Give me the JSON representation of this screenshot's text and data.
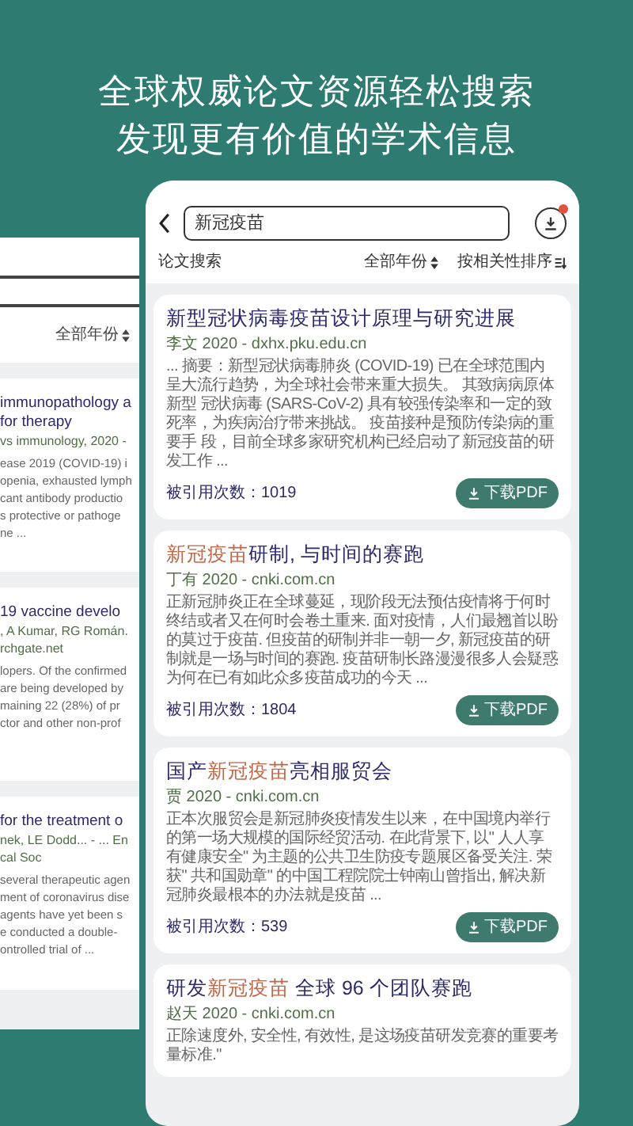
{
  "headline": [
    "全球权威论文资源轻松搜索",
    "发现更有价值的学术信息"
  ],
  "back_panel": {
    "year_filter": "全部年份",
    "cards": [
      {
        "title_lines": [
          "immunopathology a",
          "for therapy"
        ],
        "meta_lines": [
          "vs immunology, 2020 -"
        ],
        "body_lines": [
          "ease 2019 (COVID-19) i",
          "openia, exhausted lymph",
          "cant antibody productio",
          "s protective or pathoge",
          "ne ..."
        ]
      },
      {
        "title_lines": [
          "19 vaccine develo"
        ],
        "meta_lines": [
          ", A Kumar, RG Román.",
          "rchgate.net"
        ],
        "body_lines": [
          "lopers. Of the confirmed",
          "are being developed by",
          "maining 22 (28%) of pr",
          "ctor and other non-prof"
        ]
      },
      {
        "title_lines": [
          "for the treatment o"
        ],
        "meta_lines": [
          "nek, LE Dodd... - ... En",
          "cal Soc"
        ],
        "body_lines": [
          "several therapeutic agen",
          "ment of coronavirus dise",
          "agents have yet been s",
          "e conducted a double-",
          "ontrolled trial of ..."
        ]
      }
    ]
  },
  "phone": {
    "search": {
      "value": "新冠疫苗"
    },
    "download_badge": true,
    "filters": {
      "label": "论文搜索",
      "year": "全部年份",
      "sort": "按相关性排序"
    },
    "results": [
      {
        "title_parts": [
          {
            "text": "新型冠状病毒疫苗设计原理与研究进展",
            "highlight": false
          }
        ],
        "meta": "李文 2020 - dxhx.pku.edu.cn",
        "abstract": "... 摘要：新型冠状病毒肺炎 (COVID-19) 已在全球范围内呈大流行趋势，为全球社会带来重大损失。 其致病病原体新型 冠状病毒 (SARS-CoV-2) 具有较强传染率和一定的致死率，为疾病治疗带来挑战。 疫苗接种是预防传染病的重要手 段，目前全球多家研究机构已经启动了新冠疫苗的研发工作 ...",
        "citations": "被引用次数：1019",
        "download": "下载PDF"
      },
      {
        "title_parts": [
          {
            "text": "新冠疫苗",
            "highlight": true
          },
          {
            "text": "研制, 与时间的赛跑",
            "highlight": false
          }
        ],
        "meta": "丁有 2020 - cnki.com.cn",
        "abstract": "正新冠肺炎正在全球蔓延，现阶段无法预估疫情将于何时终结或者又在何时会卷土重来. 面对疫情，人们最翘首以盼的莫过于疫苗. 但疫苗的研制并非一朝一夕, 新冠疫苗的研制就是一场与时间的赛跑. 疫苗研制长路漫漫很多人会疑惑为何在已有如此众多疫苗成功的今天 ...",
        "citations": "被引用次数：1804",
        "download": "下载PDF"
      },
      {
        "title_parts": [
          {
            "text": "国产",
            "highlight": false
          },
          {
            "text": "新冠疫苗",
            "highlight": true
          },
          {
            "text": "亮相服贸会",
            "highlight": false
          }
        ],
        "meta": "贾 2020 - cnki.com.cn",
        "abstract": "正本次服贸会是新冠肺炎疫情发生以来，在中国境内举行的第一场大规模的国际经贸活动. 在此背景下, 以\" 人人享有健康安全\" 为主题的公共卫生防疫专题展区备受关注. 荣获\" 共和国勋章\" 的中国工程院院士钟南山曾指出, 解决新冠肺炎最根本的办法就是疫苗 ...",
        "citations": "被引用次数：539",
        "download": "下载PDF"
      },
      {
        "title_parts": [
          {
            "text": "研发",
            "highlight": false
          },
          {
            "text": "新冠疫苗",
            "highlight": true
          },
          {
            "text": " 全球 96 个团队赛跑",
            "highlight": false
          }
        ],
        "meta": "赵天 2020 - cnki.com.cn",
        "abstract": "正除速度外, 安全性, 有效性, 是这场疫苗研发竞赛的重要考量标准.\""
      }
    ]
  }
}
